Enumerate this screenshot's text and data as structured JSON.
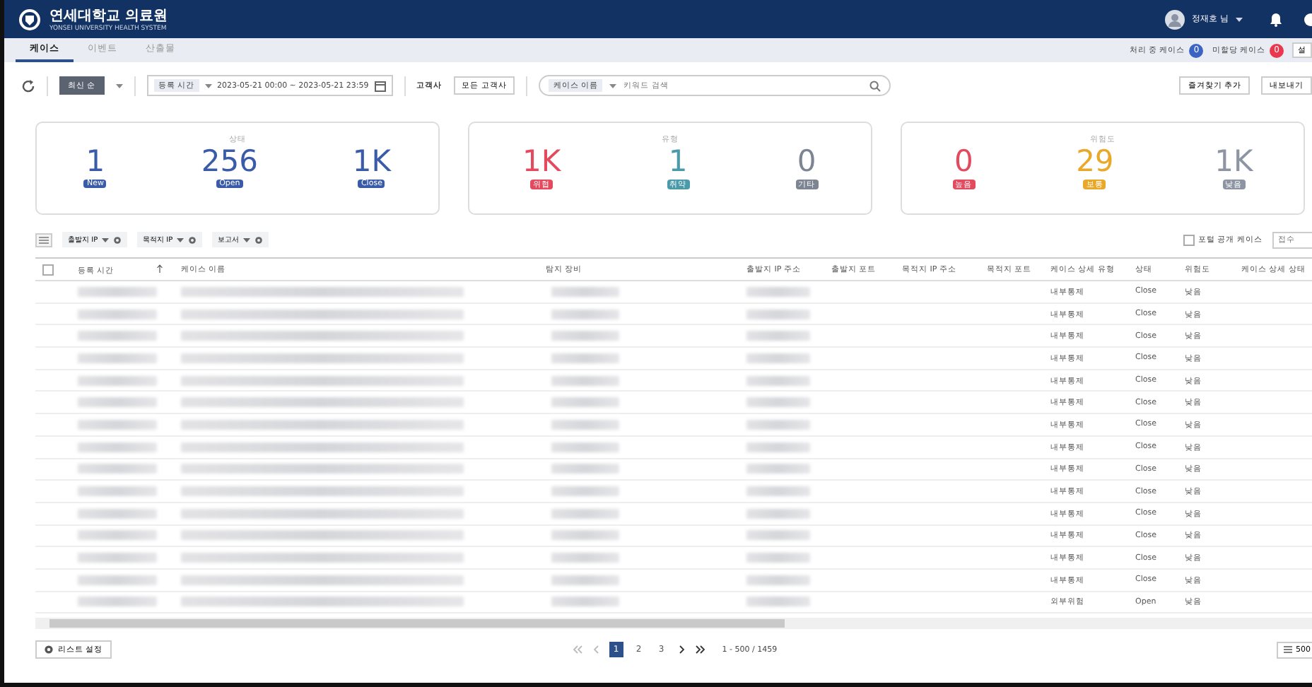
{
  "header": {
    "logo_title": "연세대학교 의료원",
    "logo_subtitle": "YONSEI UNIVERSITY HEALTH SYSTEM",
    "user": "정재호 님"
  },
  "tabs": [
    {
      "label": "케이스",
      "selected": true
    },
    {
      "label": "이벤트",
      "selected": false
    },
    {
      "label": "산출물",
      "selected": false
    }
  ],
  "case_counters": [
    {
      "label": "처리 중 케이스",
      "count": "0",
      "color": "#3b63c4"
    },
    {
      "label": "미할당 케이스",
      "count": "0",
      "color": "#e8374f"
    }
  ],
  "settings_button": "설",
  "toolbar": {
    "sort": "최신 순",
    "date_field": "등록 시간",
    "date_range": "2023-05-21 00:00 ~ 2023-05-21 23:59",
    "customer_label": "고객사",
    "customer": "모든 고객사",
    "search_field": "케이스 이름",
    "search_placeholder": "키워드 검색",
    "favorite_button": "즐겨찾기 추가",
    "export_button": "내보내기"
  },
  "summary_cards": [
    {
      "title": "상태",
      "stats": [
        {
          "value": "1",
          "label": "New",
          "color": "#3a5ba8"
        },
        {
          "value": "256",
          "label": "Open",
          "color": "#3a5ba8"
        },
        {
          "value": "1K",
          "label": "Close",
          "color": "#3a5ba8"
        }
      ]
    },
    {
      "title": "유형",
      "stats": [
        {
          "value": "1K",
          "label": "위협",
          "color": "#e34a5e"
        },
        {
          "value": "1",
          "label": "취약",
          "color": "#4a9aaa"
        },
        {
          "value": "0",
          "label": "기타",
          "color": "#7d8592"
        }
      ]
    },
    {
      "title": "위험도",
      "stats": [
        {
          "value": "0",
          "label": "높음",
          "color": "#e34a5e"
        },
        {
          "value": "29",
          "label": "보통",
          "color": "#eaa82a"
        },
        {
          "value": "1K",
          "label": "낮음",
          "color": "#8d95a3"
        }
      ]
    }
  ],
  "filters": [
    "출발지 IP",
    "목적지 IP",
    "보고서"
  ],
  "portal_checkbox": {
    "label": "포털 공개 케이스",
    "checked": false
  },
  "receive_field": {
    "placeholder": "접수"
  },
  "table": {
    "select_all": {
      "checked": false
    },
    "columns": [
      "등록 시간",
      "케이스 이름",
      "탐지 장비",
      "출발지 IP 주소",
      "출발지 포트",
      "목적지 IP 주소",
      "목적지 포트",
      "케이스 상세 유형",
      "상태",
      "위험도",
      "케이스 상세 상태"
    ],
    "rows": [
      {
        "type": "내부통제",
        "status": "Close",
        "risk": "낮음"
      },
      {
        "type": "내부통제",
        "status": "Close",
        "risk": "낮음"
      },
      {
        "type": "내부통제",
        "status": "Close",
        "risk": "낮음"
      },
      {
        "type": "내부통제",
        "status": "Close",
        "risk": "낮음"
      },
      {
        "type": "내부통제",
        "status": "Close",
        "risk": "낮음"
      },
      {
        "type": "내부통제",
        "status": "Close",
        "risk": "낮음"
      },
      {
        "type": "내부통제",
        "status": "Close",
        "risk": "낮음"
      },
      {
        "type": "내부통제",
        "status": "Close",
        "risk": "낮음"
      },
      {
        "type": "내부통제",
        "status": "Close",
        "risk": "낮음"
      },
      {
        "type": "내부통제",
        "status": "Close",
        "risk": "낮음"
      },
      {
        "type": "내부통제",
        "status": "Close",
        "risk": "낮음"
      },
      {
        "type": "내부통제",
        "status": "Close",
        "risk": "낮음"
      },
      {
        "type": "내부통제",
        "status": "Close",
        "risk": "낮음"
      },
      {
        "type": "내부통제",
        "status": "Close",
        "risk": "낮음"
      },
      {
        "type": "외부위험",
        "status": "Open",
        "risk": "낮음"
      }
    ]
  },
  "footer": {
    "list_settings": "리스트 설정",
    "pages": [
      {
        "label": "1",
        "selected": true
      },
      {
        "label": "2",
        "selected": false
      },
      {
        "label": "3",
        "selected": false
      }
    ],
    "range": "1 - 500 / 1459",
    "page_size": "500"
  }
}
